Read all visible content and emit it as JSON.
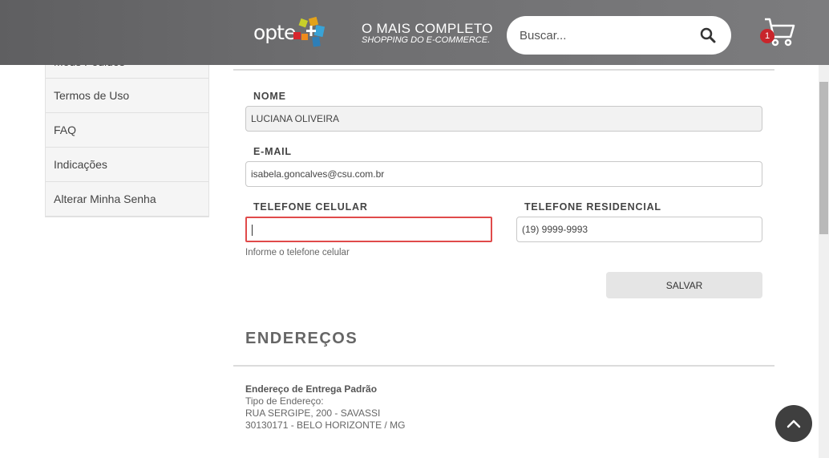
{
  "header": {
    "logo_text": "opte",
    "logo_icon": "opte-plus-logo-icon",
    "tagline_1": "O MAIS COMPLETO",
    "tagline_2": "SHOPPING DO E-COMMERCE.",
    "search_placeholder": "Buscar...",
    "search_icon": "search-icon",
    "cart_icon": "cart-icon",
    "cart_count": "1",
    "cart_badge_color": "#c9252b"
  },
  "sidebar": {
    "items": [
      {
        "label": "Meus Pedidos"
      },
      {
        "label": "Termos de Uso"
      },
      {
        "label": "FAQ"
      },
      {
        "label": "Indicações"
      },
      {
        "label": "Alterar Minha Senha"
      }
    ]
  },
  "form": {
    "nome_label": "NOME",
    "nome_value": "LUCIANA OLIVEIRA",
    "email_label": "E-MAIL",
    "email_value": "isabela.goncalves@csu.com.br",
    "celular_label": "TELEFONE CELULAR",
    "celular_value": "",
    "celular_helper": "Informe o telefone celular",
    "residencial_label": "TELEFONE RESIDENCIAL",
    "residencial_value": "(19) 9999-9993",
    "save_label": "SALVAR",
    "error_color": "#e04a4a"
  },
  "addresses": {
    "title": "ENDEREÇOS",
    "default_title": "Endereço de Entrega Padrão",
    "type_line": "Tipo de Endereço:",
    "street": "RUA SERGIPE, 200 - SAVASSI",
    "city": "30130171 - BELO HORIZONTE / MG"
  },
  "controls": {
    "back_to_top_icon": "chevron-up-icon"
  }
}
